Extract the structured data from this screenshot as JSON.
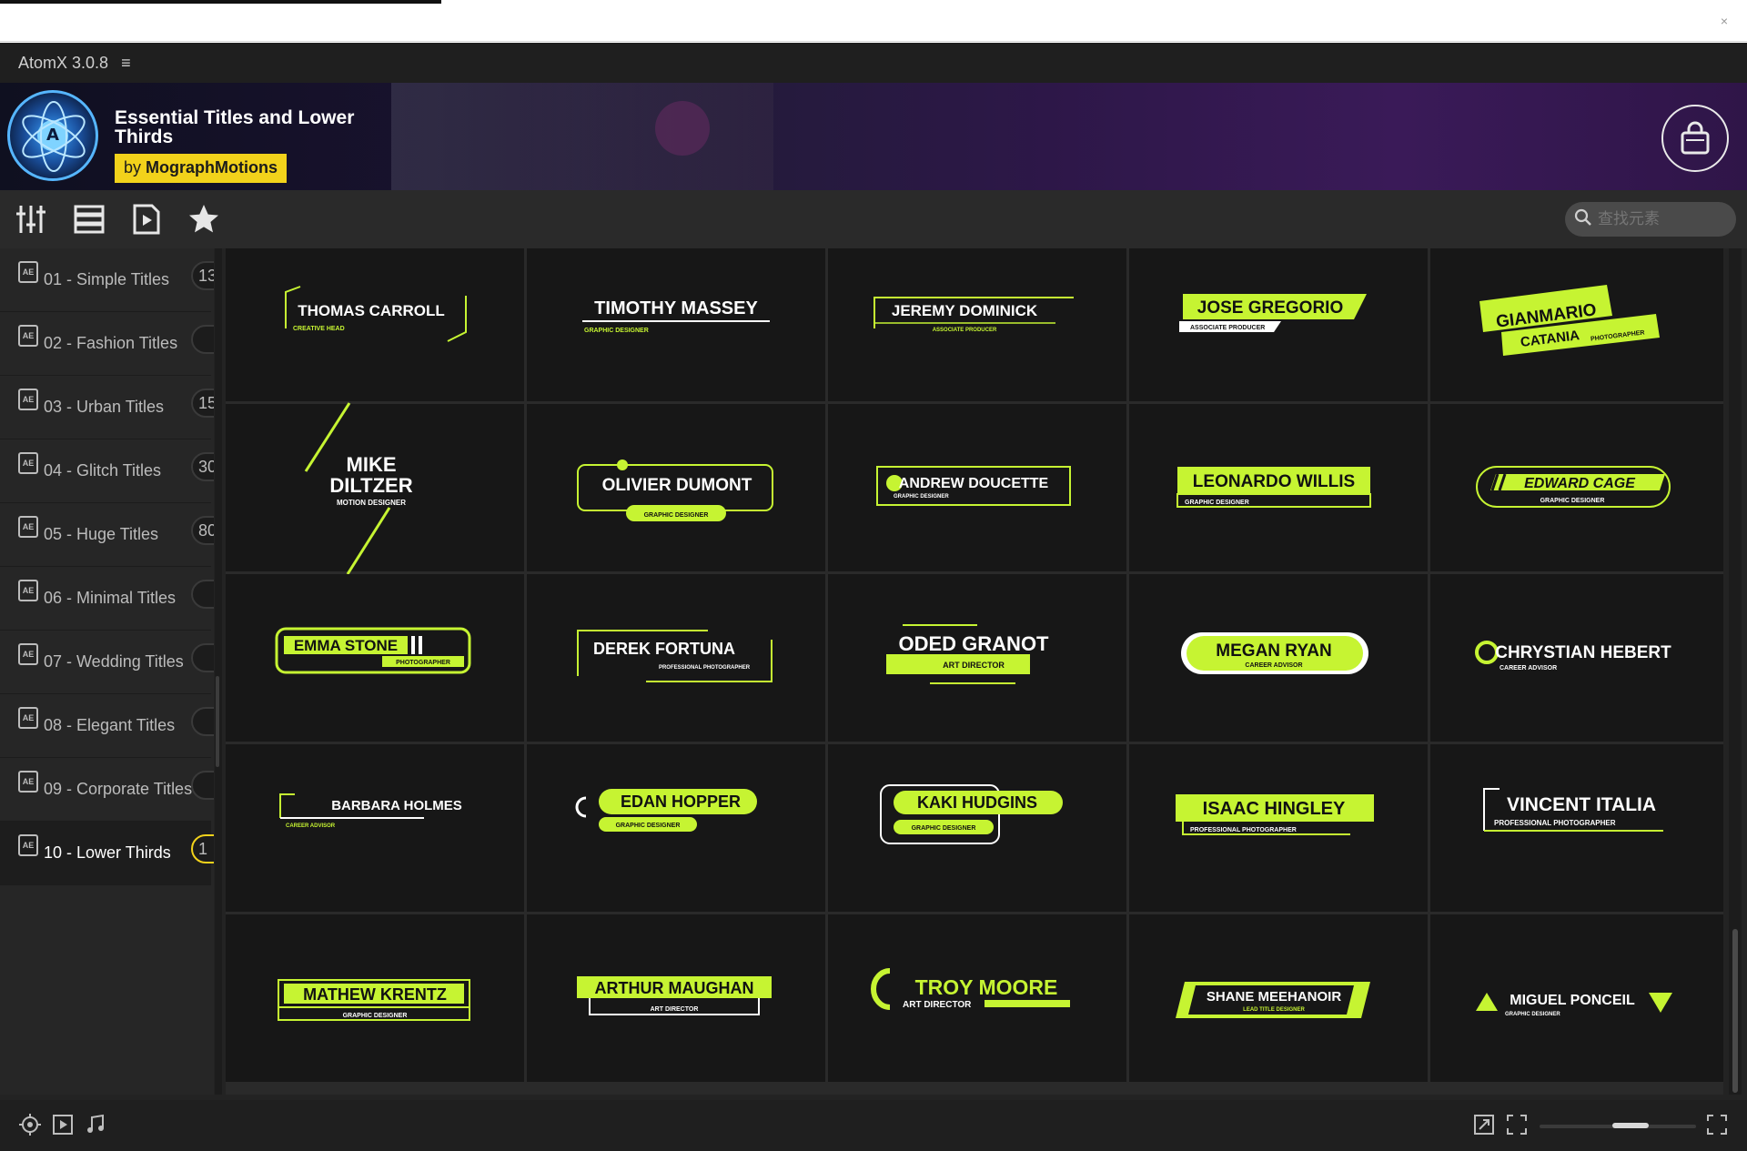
{
  "app": {
    "title": "AtomX 3.0.8"
  },
  "pack": {
    "title": "Essential Titles and Lower Thirds",
    "author_prefix": "by",
    "author": "MographMotions"
  },
  "search": {
    "placeholder": "查找元素"
  },
  "sidebar": {
    "items": [
      {
        "label": "01 - Simple Titles",
        "count": "13"
      },
      {
        "label": "02 - Fashion Titles",
        "count": ""
      },
      {
        "label": "03 - Urban Titles",
        "count": "15"
      },
      {
        "label": "04 - Glitch Titles",
        "count": "30"
      },
      {
        "label": "05 - Huge Titles",
        "count": "80"
      },
      {
        "label": "06 - Minimal Titles",
        "count": ""
      },
      {
        "label": "07 - Wedding Titles",
        "count": ""
      },
      {
        "label": "08 - Elegant Titles",
        "count": ""
      },
      {
        "label": "09 - Corporate Titles",
        "count": ""
      },
      {
        "label": "10 - Lower Thirds",
        "count": "1",
        "active": true
      }
    ]
  },
  "colors": {
    "accent": "#c6f432",
    "brand_yellow": "#f2d21b",
    "tile_bg": "#171717"
  },
  "grid": {
    "tiles": [
      {
        "name": "THOMAS CARROLL",
        "role": "CREATIVE HEAD"
      },
      {
        "name": "TIMOTHY MASSEY",
        "role": "GRAPHIC DESIGNER"
      },
      {
        "name": "JEREMY DOMINICK",
        "role": "ASSOCIATE PRODUCER"
      },
      {
        "name": "JOSE GREGORIO",
        "role": "ASSOCIATE PRODUCER"
      },
      {
        "name": "GIANMARIO",
        "name2": "CATANIA",
        "role": "PHOTOGRAPHER"
      },
      {
        "name": "MIKE",
        "name2": "DILTZER",
        "role": "MOTION DESIGNER"
      },
      {
        "name": "OLIVIER DUMONT",
        "role": "GRAPHIC DESIGNER"
      },
      {
        "name": "ANDREW DOUCETTE",
        "role": "GRAPHIC DESIGNER"
      },
      {
        "name": "LEONARDO WILLIS",
        "role": "GRAPHIC DESIGNER"
      },
      {
        "name": "EDWARD CAGE",
        "role": "GRAPHIC DESIGNER"
      },
      {
        "name": "EMMA STONE",
        "role": "PHOTOGRAPHER"
      },
      {
        "name": "DEREK FORTUNA",
        "role": "PROFESSIONAL PHOTOGRAPHER"
      },
      {
        "name": "ODED GRANOT",
        "role": "ART DIRECTOR"
      },
      {
        "name": "MEGAN RYAN",
        "role": "CAREER ADVISOR"
      },
      {
        "name": "CHRYSTIAN HEBERT",
        "role": "CAREER ADVISOR"
      },
      {
        "name": "BARBARA HOLMES",
        "role": "CAREER ADVISOR"
      },
      {
        "name": "EDAN HOPPER",
        "role": "GRAPHIC DESIGNER"
      },
      {
        "name": "KAKI HUDGINS",
        "role": "GRAPHIC DESIGNER"
      },
      {
        "name": "ISAAC HINGLEY",
        "role": "PROFESSIONAL PHOTOGRAPHER"
      },
      {
        "name": "VINCENT ITALIA",
        "role": "PROFESSIONAL PHOTOGRAPHER"
      },
      {
        "name": "MATHEW KRENTZ",
        "role": "GRAPHIC DESIGNER"
      },
      {
        "name": "ARTHUR MAUGHAN",
        "role": "ART DIRECTOR"
      },
      {
        "name": "TROY MOORE",
        "role": "ART DIRECTOR"
      },
      {
        "name": "SHANE MEEHANOIR",
        "role": "LEAD TITLE DESIGNER"
      },
      {
        "name": "MIGUEL PONCEIL",
        "role": "GRAPHIC DESIGNER"
      }
    ]
  },
  "icons": {
    "toolbar": [
      "sliders-icon",
      "list-icon",
      "play-file-icon",
      "star-icon"
    ],
    "bottom_left": [
      "target-icon",
      "play-box-icon",
      "music-note-icon"
    ],
    "bottom_right": [
      "export-icon",
      "fullscreen-icon",
      "expand-icon"
    ]
  }
}
